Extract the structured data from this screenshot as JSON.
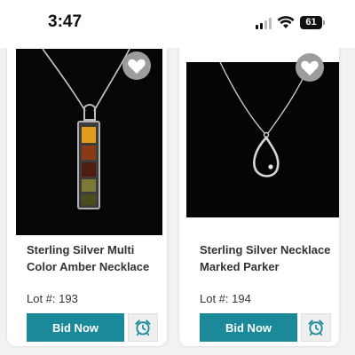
{
  "status_bar": {
    "time": "3:47",
    "battery": "61",
    "icons": [
      "signal-icon",
      "wifi-icon",
      "battery-icon"
    ]
  },
  "colors": {
    "accent": "#1a8a9a",
    "card_background": "#ffffff",
    "page_background": "#f2f2f2",
    "favorite_circle": "#9c9c9c"
  },
  "lots": [
    {
      "title": "Sterling Silver Multi Color Amber Necklace",
      "lot_label": "Lot #: 193",
      "bid_label": "Bid Now",
      "favorite_icon": "heart-icon",
      "reminder_icon": "alarm-clock-icon"
    },
    {
      "title": "Sterling Silver Necklace Marked Parker",
      "lot_label": "Lot #: 194",
      "bid_label": "Bid Now",
      "favorite_icon": "heart-icon",
      "reminder_icon": "alarm-clock-icon"
    }
  ]
}
